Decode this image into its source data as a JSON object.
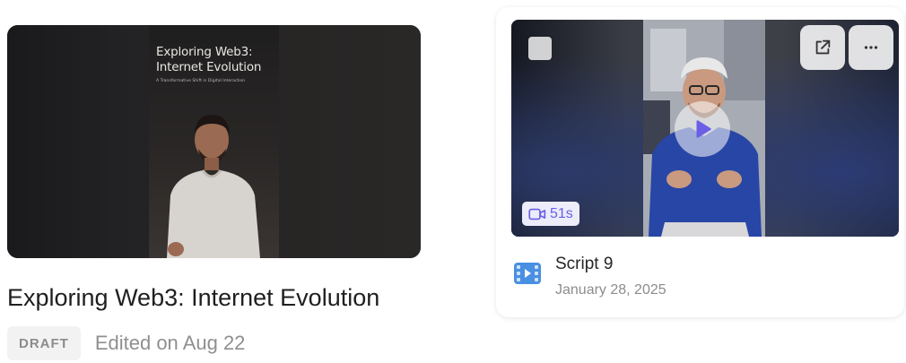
{
  "left_card": {
    "thumbnail": {
      "video_title": "Exploring Web3: Internet Evolution",
      "video_subtitle": "A Transformative Shift in Digital Interaction"
    },
    "title": "Exploring Web3: Internet Evolution",
    "status_badge": "DRAFT",
    "edited_text": "Edited on Aug 22"
  },
  "right_card": {
    "duration": "51s",
    "title": "Script 9",
    "date": "January 28, 2025",
    "icons": [
      "checkbox",
      "external-link-icon",
      "more-options-icon",
      "play-icon",
      "video-camera-icon",
      "video-doc-icon"
    ],
    "colors": {
      "accent": "#6a5fe6",
      "doc_icon": "#4a90e2"
    }
  }
}
